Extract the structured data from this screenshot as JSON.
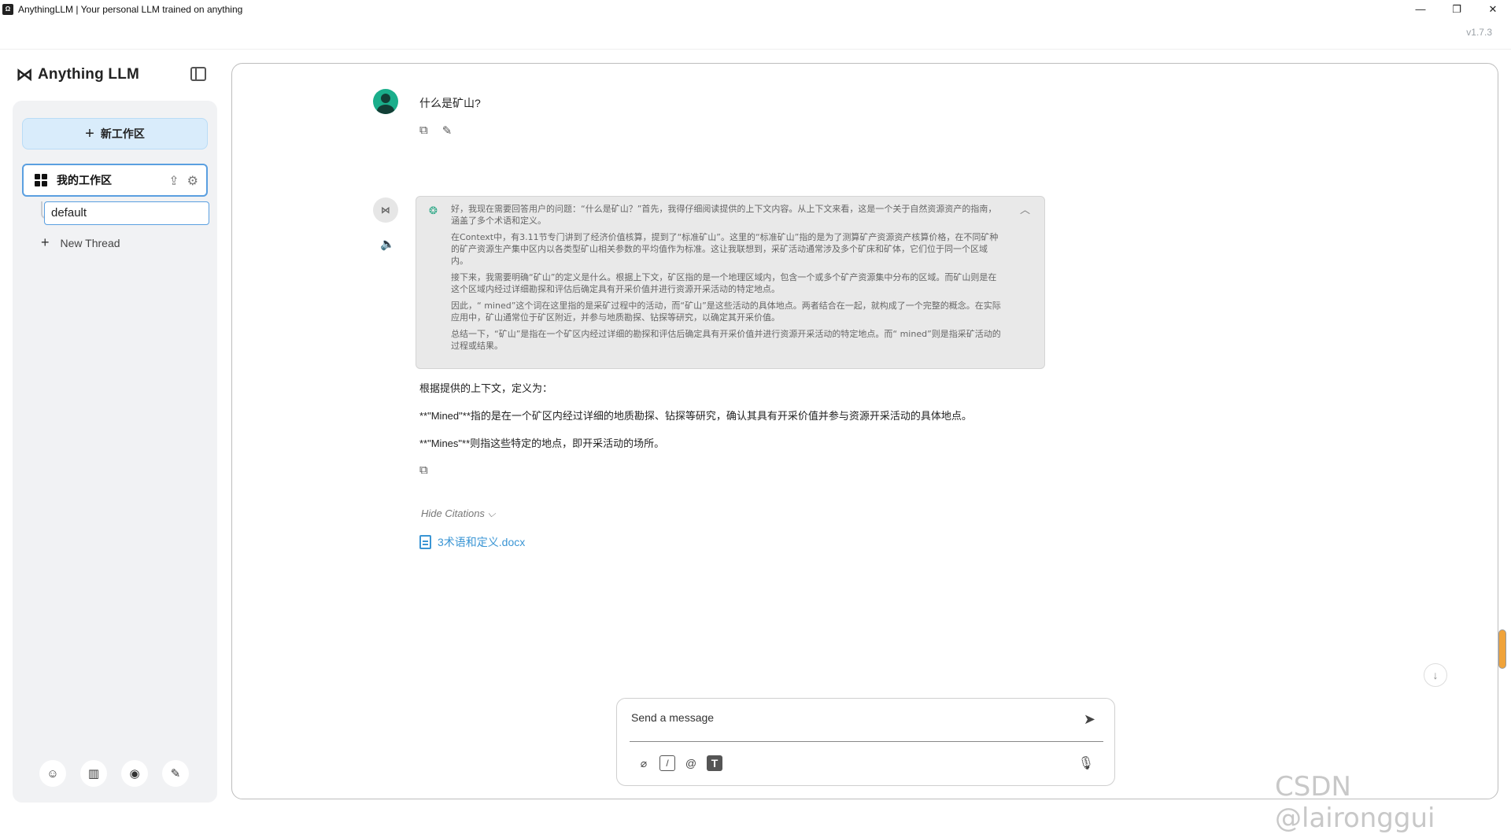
{
  "window": {
    "title": "AnythingLLM | Your personal LLM trained on anything",
    "app_icon_text": "Ω",
    "minimize": "—",
    "restore": "❐",
    "close": "✕"
  },
  "version": "v1.7.3",
  "brand": {
    "logo": "⋈",
    "name": "Anything LLM"
  },
  "sidebar": {
    "new_workspace": "新工作区",
    "workspace": {
      "name": "我的工作区",
      "upload_icon": "⇪",
      "settings_icon": "⚙"
    },
    "thread_default": "default",
    "new_thread": "New Thread",
    "footer_icons": [
      "community-icon",
      "docs-icon",
      "discord-icon",
      "settings-wrench-icon"
    ]
  },
  "chat": {
    "user_message": "什么是矿山?",
    "thought": [
      "好，我现在需要回答用户的问题：“什么是矿山？”首先，我得仔细阅读提供的上下文内容。从上下文来看，这是一个关于自然资源资产的指南，涵盖了多个术语和定义。",
      "在Context中，有3.11节专门讲到了经济价值核算，提到了“标准矿山”。这里的“标准矿山”指的是为了测算矿产资源资产核算价格，在不同矿种的矿产资源生产集中区内以各类型矿山相关参数的平均值作为标准。这让我联想到，采矿活动通常涉及多个矿床和矿体，它们位于同一个区域内。",
      "接下来，我需要明确“矿山”的定义是什么。根据上下文，矿区指的是一个地理区域内，包含一个或多个矿产资源集中分布的区域。而矿山则是在这个区域内经过详细勘探和评估后确定具有开采价值并进行资源开采活动的特定地点。",
      "因此，“ mined”这个词在这里指的是采矿过程中的活动，而“矿山”是这些活动的具体地点。两者结合在一起，就构成了一个完整的概念。在实际应用中，矿山通常位于矿区附近，并参与地质勘探、钻探等研究，以确定其开采价值。",
      "总结一下，“矿山”是指在一个矿区内经过详细的勘探和评估后确定具有开采价值并进行资源开采活动的特定地点。而“ mined”则是指采矿活动的过程或结果。"
    ],
    "answer": [
      "根据提供的上下文，定义为：",
      "**\"Mined\"**指的是在一个矿区内经过详细的地质勘探、钻探等研究，确认其具有开采价值并参与资源开采活动的具体地点。",
      "**\"Mines\"**则指这些特定的地点，即开采活动的场所。"
    ],
    "hide_citations": "Hide Citations ⌵",
    "citation_file": "3术语和定义.docx"
  },
  "composer": {
    "placeholder": "Send a message"
  },
  "watermark": "CSDN @laironggui"
}
